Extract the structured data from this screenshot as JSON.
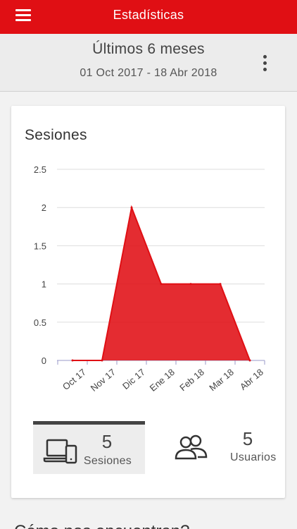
{
  "appbar": {
    "title": "Estadísticas",
    "menu_icon": "hamburger-menu-icon"
  },
  "range": {
    "title": "Últimos 6 meses",
    "dates": "01 Oct 2017 - 18 Abr 2018",
    "more_icon": "more-vertical-icon"
  },
  "card": {
    "title": "Sesiones"
  },
  "chart_data": {
    "type": "area",
    "categories": [
      "Oct 17",
      "Nov 17",
      "Dic 17",
      "Ene 18",
      "Feb 18",
      "Mar 18",
      "Abr 18"
    ],
    "values": [
      0,
      0,
      2,
      1,
      1,
      1,
      0
    ],
    "ylim": [
      0,
      2.5
    ],
    "yticks": [
      "0",
      "0.5",
      "1",
      "1.5",
      "2",
      "2.5"
    ],
    "grid": true,
    "color": "#e00f14"
  },
  "stats": {
    "sessions": {
      "value": "5",
      "label": "Sesiones",
      "icon": "devices-icon",
      "active": true
    },
    "users": {
      "value": "5",
      "label": "Usuarios",
      "icon": "users-icon",
      "active": false
    }
  },
  "next_section": {
    "title": "Cómo nos encuentran?"
  },
  "colors": {
    "primary": "#e00f14",
    "text": "#333333",
    "grid": "#dddddd"
  }
}
